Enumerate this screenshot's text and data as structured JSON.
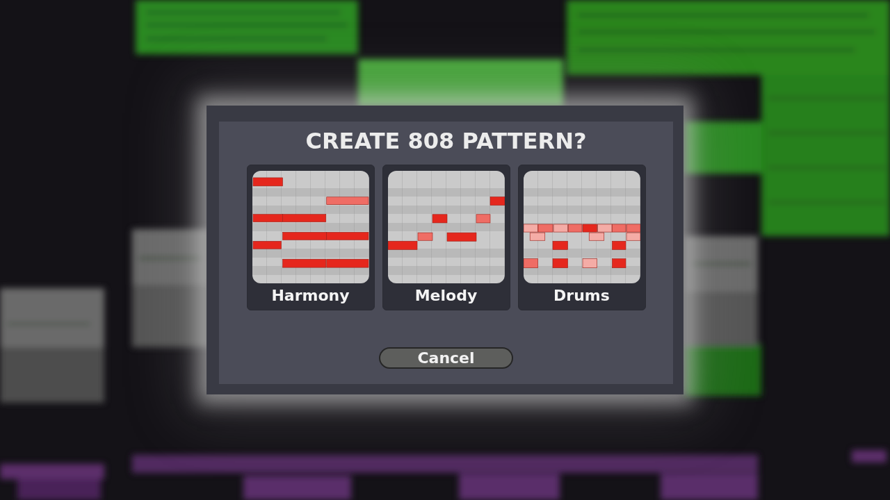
{
  "dialog": {
    "title": "CREATE 808 PATTERN?",
    "options": [
      {
        "label": "Harmony",
        "kind": "harmony"
      },
      {
        "label": "Melody",
        "kind": "melody"
      },
      {
        "label": "Drums",
        "kind": "drums"
      }
    ],
    "cancel_button": "Cancel"
  }
}
